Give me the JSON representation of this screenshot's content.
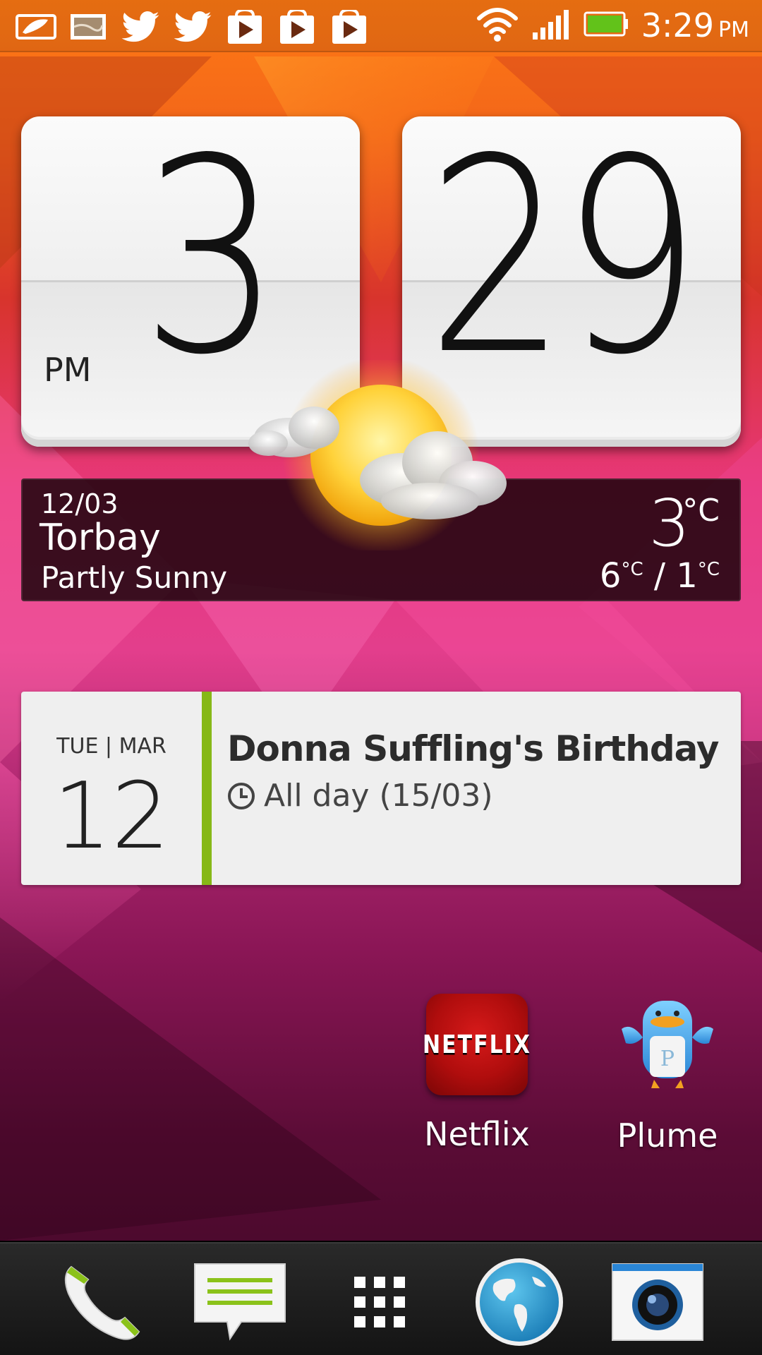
{
  "status_bar": {
    "notification_icons": [
      "reader-icon",
      "image-icon",
      "twitter-icon",
      "twitter-icon",
      "play-store-icon",
      "play-store-icon",
      "play-store-icon"
    ],
    "time": "3:29",
    "ampm": "PM"
  },
  "clock_widget": {
    "hour": "3",
    "minute": "29",
    "ampm": "PM"
  },
  "weather": {
    "date": "12/03",
    "city": "Torbay",
    "condition": "Partly Sunny",
    "temperature": "3",
    "unit": "°C",
    "high": "6",
    "low": "1",
    "range_unit": "°C",
    "range_separator": " / "
  },
  "calendar": {
    "day_month": "TUE | MAR",
    "day": "12",
    "event_title": "Donna Suffling's Birthday",
    "event_time": "All day (15/03)",
    "accent_color": "#86b817"
  },
  "apps": [
    {
      "label": "Netflix",
      "logo_text": "NETFLIX"
    },
    {
      "label": "Plume"
    }
  ],
  "dock": [
    "phone-icon",
    "messages-icon",
    "app-drawer-icon",
    "browser-icon",
    "camera-icon"
  ]
}
